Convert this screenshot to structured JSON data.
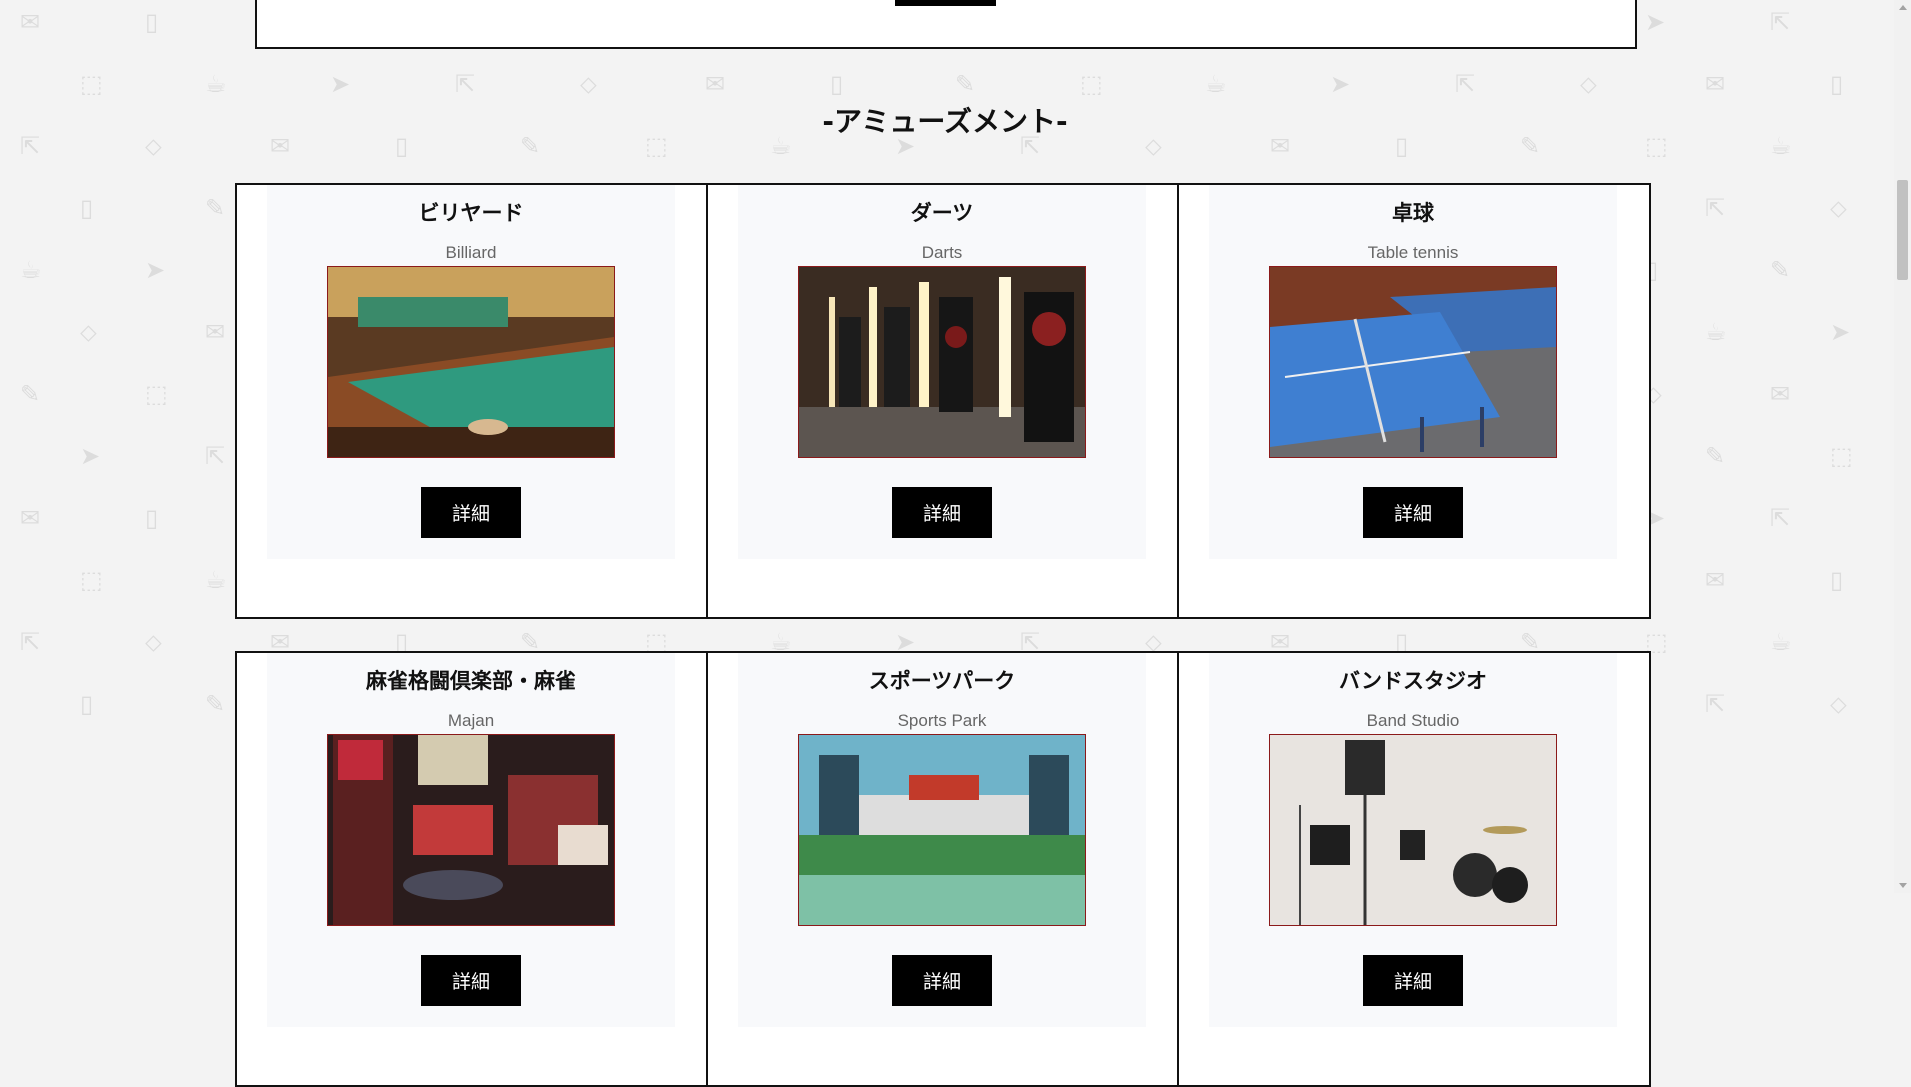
{
  "section": {
    "title": "-アミューズメント-"
  },
  "cards": [
    {
      "title": "ビリヤード",
      "subtitle": "Billiard",
      "button": "詳細",
      "photo_icon": "billiard-photo"
    },
    {
      "title": "ダーツ",
      "subtitle": "Darts",
      "button": "詳細",
      "photo_icon": "darts-photo"
    },
    {
      "title": "卓球",
      "subtitle": "Table tennis",
      "button": "詳細",
      "photo_icon": "table-tennis-photo"
    },
    {
      "title": "麻雀格闘倶楽部・麻雀",
      "subtitle": "Majan",
      "button": "詳細",
      "photo_icon": "mahjong-photo"
    },
    {
      "title": "スポーツパーク",
      "subtitle": "Sports Park",
      "button": "詳細",
      "photo_icon": "sports-park-photo"
    },
    {
      "title": "バンドスタジオ",
      "subtitle": "Band Studio",
      "button": "詳細",
      "photo_icon": "band-studio-photo"
    }
  ],
  "colors": {
    "background": "#f3f3f3",
    "card_border": "#111111",
    "button": "#000000",
    "photo_border": "#8b1a1a"
  }
}
